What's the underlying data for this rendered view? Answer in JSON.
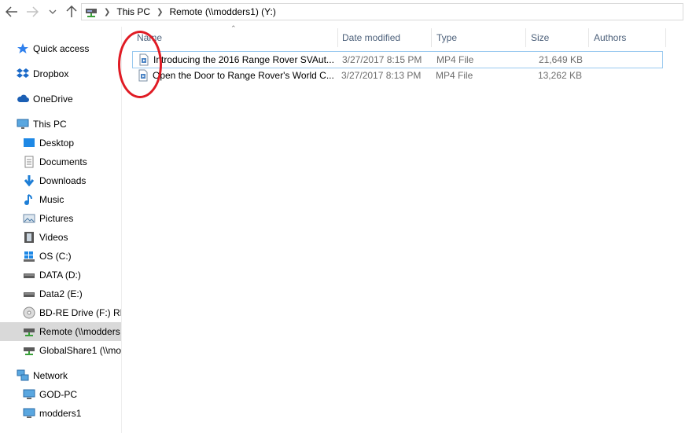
{
  "window": {
    "address": {
      "root_icon": "network-drive-icon",
      "crumbs": [
        "This PC",
        "Remote (\\\\modders1) (Y:)"
      ]
    }
  },
  "sidebar": {
    "items": [
      {
        "label": "Quick access",
        "icon": "star-icon"
      },
      {
        "label": "Dropbox",
        "icon": "dropbox-icon"
      },
      {
        "label": "OneDrive",
        "icon": "cloud-icon"
      },
      {
        "label": "This PC",
        "icon": "computer-icon"
      },
      {
        "label": "Desktop",
        "icon": "desktop-icon"
      },
      {
        "label": "Documents",
        "icon": "documents-icon"
      },
      {
        "label": "Downloads",
        "icon": "download-arrow-icon"
      },
      {
        "label": "Music",
        "icon": "music-note-icon"
      },
      {
        "label": "Pictures",
        "icon": "pictures-icon"
      },
      {
        "label": "Videos",
        "icon": "film-icon"
      },
      {
        "label": "OS (C:)",
        "icon": "windows-drive-icon"
      },
      {
        "label": "DATA (D:)",
        "icon": "drive-icon"
      },
      {
        "label": "Data2 (E:)",
        "icon": "drive-icon"
      },
      {
        "label": "BD-RE Drive (F:) RN",
        "icon": "disc-icon"
      },
      {
        "label": "Remote (\\\\modders",
        "icon": "network-drive-icon"
      },
      {
        "label": "GlobalShare1 (\\\\mo",
        "icon": "network-drive-icon"
      },
      {
        "label": "Network",
        "icon": "network-icon"
      },
      {
        "label": "GOD-PC",
        "icon": "monitor-icon"
      },
      {
        "label": "modders1",
        "icon": "monitor-icon"
      }
    ]
  },
  "columns": {
    "name": "Name",
    "date": "Date modified",
    "type": "Type",
    "size": "Size",
    "authors": "Authors"
  },
  "files": [
    {
      "name": "Introducing the 2016 Range Rover SVAut...",
      "date": "3/27/2017 8:15 PM",
      "type": "MP4 File",
      "size": "21,649 KB",
      "icon": "video-file-icon"
    },
    {
      "name": "Open the Door to Range Rover's World C...",
      "date": "3/27/2017 8:13 PM",
      "type": "MP4 File",
      "size": "13,262 KB",
      "icon": "video-file-icon"
    }
  ],
  "colors": {
    "header_text": "#4c607a",
    "selection": "#d9d9d9",
    "focus_border": "#99c9ef",
    "annotation": "#e01b24"
  }
}
